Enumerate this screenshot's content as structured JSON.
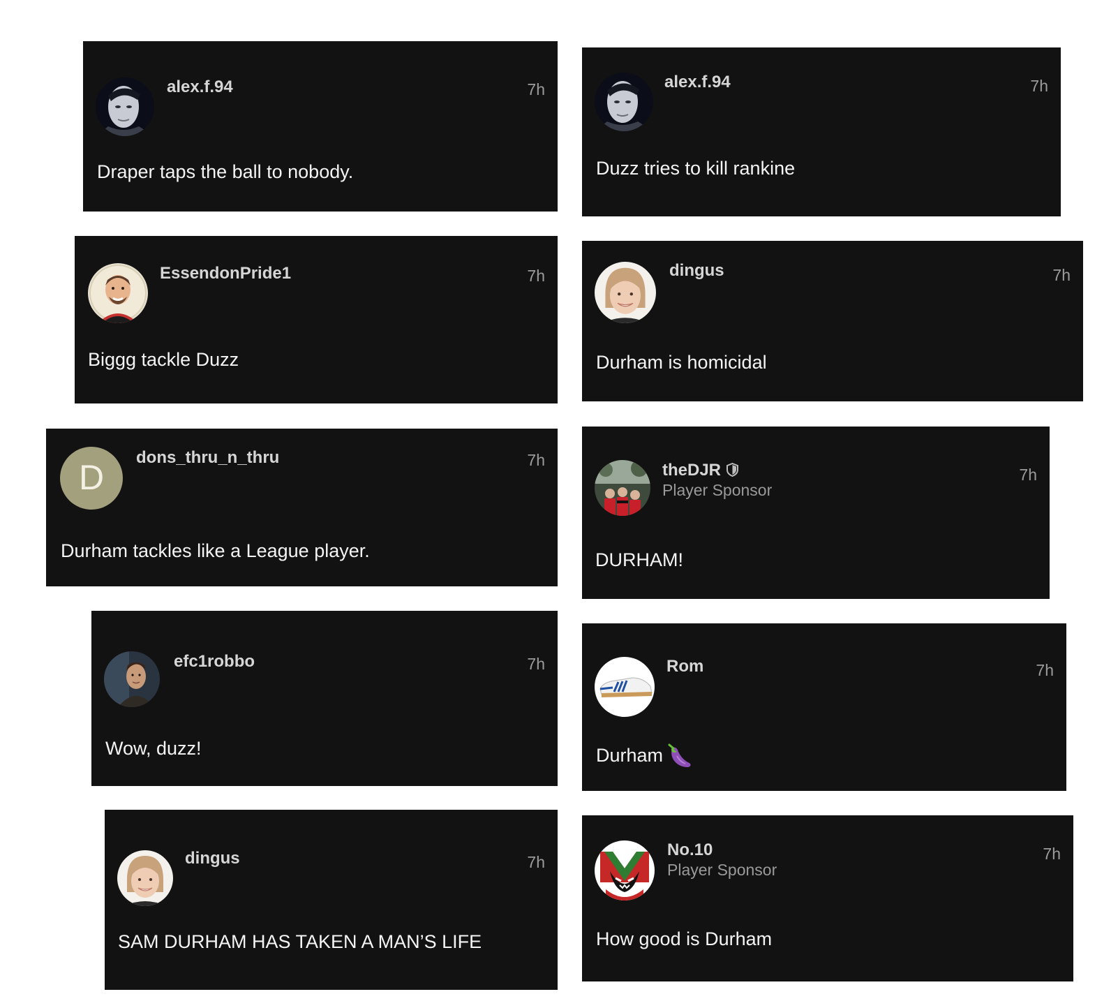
{
  "time_label": "7h",
  "left": [
    {
      "username": "alex.f.94",
      "message": "Draper taps the ball to nobody.",
      "avatar": "man-face-avatar"
    },
    {
      "username": "EssendonPride1",
      "message": "Biggg tackle Duzz",
      "avatar": "smiling-man-avatar"
    },
    {
      "username": "dons_thru_n_thru",
      "message": "Durham tackles like a League player.",
      "avatar_letter": "D"
    },
    {
      "username": "efc1robbo",
      "message": "Wow, duzz!",
      "avatar": "man-in-car-avatar"
    },
    {
      "username": "dingus",
      "message": "SAM DURHAM HAS TAKEN A MAN’S LIFE",
      "avatar": "woman-face-avatar"
    }
  ],
  "right": [
    {
      "username": "alex.f.94",
      "message": "Duzz tries to kill rankine",
      "avatar": "man-face-avatar"
    },
    {
      "username": "dingus",
      "message": "Durham is homicidal",
      "avatar": "woman-face-avatar"
    },
    {
      "username": "theDJR",
      "subtitle": "Player Sponsor",
      "message": "DURHAM!",
      "avatar": "team-photo-avatar",
      "badge": "shield-icon"
    },
    {
      "username": "Rom",
      "message": "Durham",
      "emoji": "eggplant-emoji",
      "avatar": "sneaker-avatar"
    },
    {
      "username": "No.10",
      "subtitle": "Player Sponsor",
      "message": "How good is Durham",
      "avatar": "devil-logo-avatar"
    }
  ],
  "colors": {
    "card_bg": "#121212",
    "page_bg": "#ffffff",
    "username": "#d6d6d6",
    "subtitle": "#9a9a9a",
    "time": "#9c9c9c",
    "message": "#f4f4f4",
    "letter_avatar_bg": "#a3a07e"
  }
}
